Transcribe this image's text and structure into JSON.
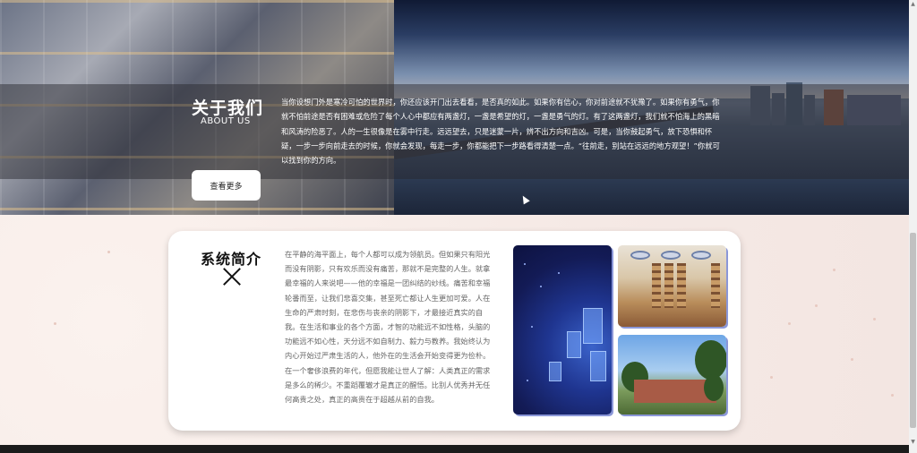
{
  "about": {
    "title": "关于我们",
    "subtitle": "ABOUT US",
    "text": "当你设想门外是寒冷可怕的世界时，你还应该开门出去看看，是否真的如此。如果你有信心，你对前途就不犹豫了。如果你有勇气，你就不怕前途是否有困难或危险了每个人心中都应有两盏灯，一盏是希望的灯，一盏是勇气的灯。有了这两盏灯，我们就不怕海上的黑暗和风涛的险恶了。人的一生很像是在雾中行走。远远望去，只是迷蒙一片，辨不出方向和吉凶。可是，当你鼓起勇气，放下恐惧和怀疑，一步一步向前走去的时候，你就会发现，每走一步，你都能把下一步路看得清楚一点。“往前走，别站在远远的地方观望！”你就可以找到你的方向。",
    "button_label": "查看更多"
  },
  "system": {
    "title": "系统简介",
    "text": "在平静的海平面上，每个人都可以成为领航员。但如果只有阳光而没有阴影，只有欢乐而没有痛苦，那就不是完整的人生。就拿最幸福的人来说吧——他的幸福是一团纠结的纱线。痛苦和幸福轮番而至，让我们悲喜交集，甚至死亡都让人生更加可爱。人在生命的严肃时刻，在悲伤与丧亲的阴影下，才最接近真实的自我。在生活和事业的各个方面，才智的功能远不如性格，头脑的功能远不如心性，天分远不如自制力、毅力与教养。我始终认为内心开始过严肃生活的人，他外在的生活会开始变得更为俭朴。在一个奢侈浪费的年代，但愿我能让世人了解：人类真正的需求是多么的稀少。不重蹈覆辙才是真正的醒悟。比别人优秀并无任何高贵之处，真正的高贵在于超越从前的自我。"
  },
  "icons": {
    "close": "close-icon",
    "scroll_up": "scroll-up-arrow-icon",
    "scroll_down": "scroll-down-arrow-icon"
  },
  "colors": {
    "image_shadow": "#8b97d8",
    "lower_bg": "#f6ece8"
  }
}
